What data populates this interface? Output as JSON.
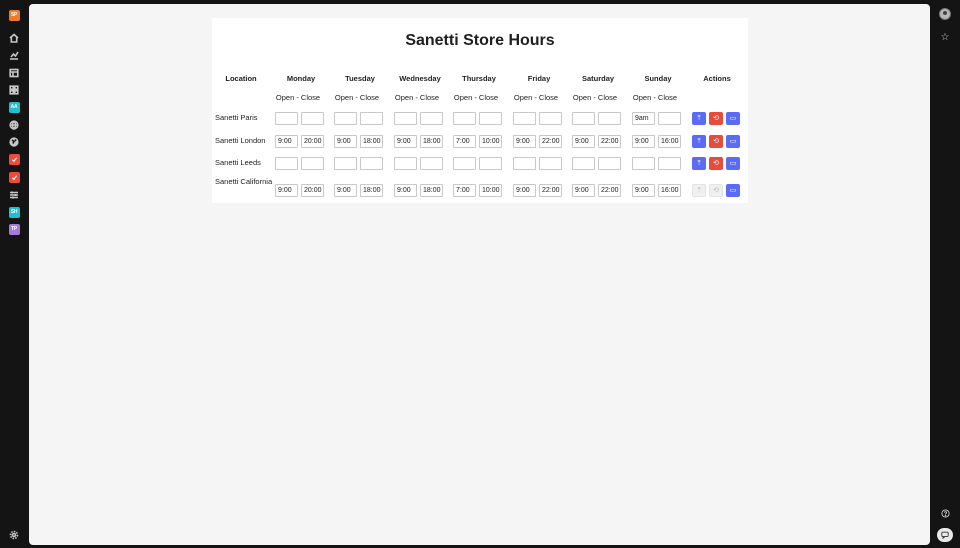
{
  "left_rail": {
    "top_badge": {
      "text": "SP",
      "color": "#f07b2a"
    },
    "items": [
      {
        "icon": "home-icon"
      },
      {
        "icon": "chart-icon"
      },
      {
        "icon": "table-icon"
      },
      {
        "icon": "grid-icon"
      },
      {
        "badge": "AA",
        "color": "#1ebfd1"
      },
      {
        "icon": "globe-icon"
      },
      {
        "icon": "world-icon"
      },
      {
        "badge": "check",
        "color": "#ef4b3b"
      },
      {
        "badge": "check",
        "color": "#ef4b3b"
      },
      {
        "icon": "sliders-icon"
      },
      {
        "badge": "SH",
        "color": "#1ebfd1"
      },
      {
        "badge": "TP",
        "color": "#a57bd9"
      }
    ],
    "settings_icon": "gear-icon"
  },
  "right_rail": {
    "avatar": "user-avatar",
    "star_icon": "star-icon",
    "help_icon": "help-icon",
    "chat_icon": "chat-icon"
  },
  "page": {
    "title": "Sanetti Store Hours",
    "columns": {
      "location": "Location",
      "days": [
        "Monday",
        "Tuesday",
        "Wednesday",
        "Thursday",
        "Friday",
        "Saturday",
        "Sunday"
      ],
      "actions": "Actions"
    },
    "subheader": "Open - Close",
    "rows": [
      {
        "location": "Sanetti Paris",
        "hours": [
          [
            "",
            ""
          ],
          [
            "",
            ""
          ],
          [
            "",
            ""
          ],
          [
            "",
            ""
          ],
          [
            "",
            ""
          ],
          [
            "",
            ""
          ],
          [
            "9am",
            ""
          ]
        ],
        "actions_enabled": true
      },
      {
        "location": "Sanetti London",
        "hours": [
          [
            "9:00",
            "20:00"
          ],
          [
            "9:00",
            "18:00"
          ],
          [
            "9:00",
            "18:00"
          ],
          [
            "7:00",
            "10:00"
          ],
          [
            "9:00",
            "22:00"
          ],
          [
            "9:00",
            "22:00"
          ],
          [
            "9:00",
            "16:00"
          ]
        ],
        "actions_enabled": true
      },
      {
        "location": "Sanetti Leeds",
        "hours": [
          [
            "",
            ""
          ],
          [
            "",
            ""
          ],
          [
            "",
            ""
          ],
          [
            "",
            ""
          ],
          [
            "",
            ""
          ],
          [
            "",
            ""
          ],
          [
            "",
            ""
          ]
        ],
        "actions_enabled": true
      },
      {
        "location": "Sanetti California",
        "hours": [
          [
            "9:00",
            "20:00"
          ],
          [
            "9:00",
            "18:00"
          ],
          [
            "9:00",
            "18:00"
          ],
          [
            "7:00",
            "10:00"
          ],
          [
            "9:00",
            "22:00"
          ],
          [
            "9:00",
            "22:00"
          ],
          [
            "9:00",
            "16:00"
          ]
        ],
        "actions_enabled": false
      }
    ],
    "colors": {
      "action_blue": "#5b6bf3",
      "action_red": "#e84b3c"
    }
  }
}
